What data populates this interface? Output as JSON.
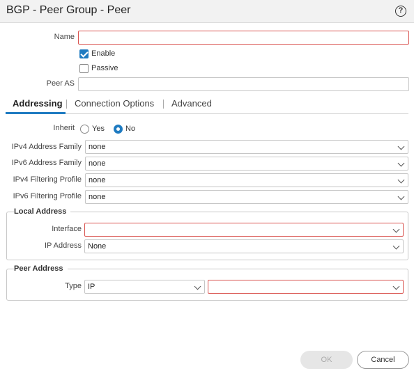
{
  "dialog": {
    "title": "BGP - Peer Group - Peer",
    "help_glyph": "?"
  },
  "form": {
    "name_label": "Name",
    "name_value": "",
    "enable_label": "Enable",
    "enable_checked": true,
    "passive_label": "Passive",
    "passive_checked": false,
    "peer_as_label": "Peer AS",
    "peer_as_value": ""
  },
  "tabs": [
    {
      "label": "Addressing",
      "active": true
    },
    {
      "label": "Connection Options",
      "active": false
    },
    {
      "label": "Advanced",
      "active": false
    }
  ],
  "addressing": {
    "inherit_label": "Inherit",
    "inherit_yes": "Yes",
    "inherit_no": "No",
    "inherit_selected": "No",
    "ipv4_af_label": "IPv4 Address Family",
    "ipv4_af_value": "none",
    "ipv6_af_label": "IPv6 Address Family",
    "ipv6_af_value": "none",
    "ipv4_fp_label": "IPv4 Filtering Profile",
    "ipv4_fp_value": "none",
    "ipv6_fp_label": "IPv6 Filtering Profile",
    "ipv6_fp_value": "none"
  },
  "local_address": {
    "title": "Local Address",
    "interface_label": "Interface",
    "interface_value": "",
    "ip_label": "IP Address",
    "ip_value": "None"
  },
  "peer_address": {
    "title": "Peer Address",
    "type_label": "Type",
    "type_value": "IP",
    "address_value": ""
  },
  "buttons": {
    "ok": "OK",
    "cancel": "Cancel",
    "ok_enabled": false
  },
  "colors": {
    "accent": "#1f7bc1",
    "required_border": "#d9534f"
  }
}
